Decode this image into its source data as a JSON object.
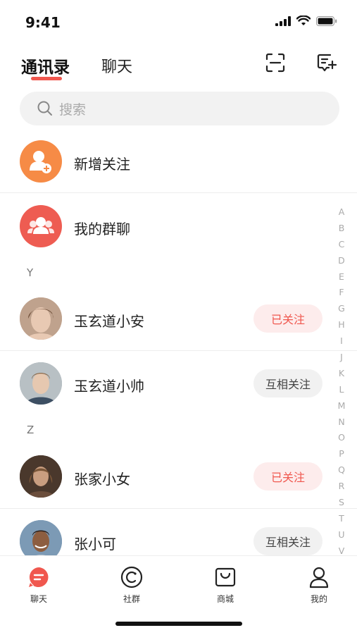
{
  "status_bar": {
    "time": "9:41"
  },
  "header": {
    "tabs": [
      {
        "label": "通讯录",
        "active": true
      },
      {
        "label": "聊天",
        "active": false
      }
    ],
    "icons": [
      "scan-icon",
      "compose-message-icon"
    ]
  },
  "search": {
    "placeholder": "搜索"
  },
  "shortcuts": [
    {
      "label": "新增关注",
      "icon": "add-user-icon",
      "color": "#f68b46"
    },
    {
      "label": "我的群聊",
      "icon": "group-icon",
      "color": "#ee5c52"
    }
  ],
  "sections": [
    {
      "letter": "Y",
      "contacts": [
        {
          "name": "玉玄道小安",
          "follow_label": "已关注",
          "follow_state": "followed"
        },
        {
          "name": "玉玄道小帅",
          "follow_label": "互相关注",
          "follow_state": "mutual"
        }
      ]
    },
    {
      "letter": "Z",
      "contacts": [
        {
          "name": "张家小女",
          "follow_label": "已关注",
          "follow_state": "followed"
        },
        {
          "name": "张小可",
          "follow_label": "互相关注",
          "follow_state": "mutual"
        }
      ]
    }
  ],
  "alphabet_index": [
    "A",
    "B",
    "C",
    "D",
    "E",
    "F",
    "G",
    "H",
    "I",
    "J",
    "K",
    "L",
    "M",
    "N",
    "O",
    "P",
    "Q",
    "R",
    "S",
    "T",
    "U",
    "V"
  ],
  "bottom_nav": [
    {
      "label": "聊天",
      "icon": "chat-icon",
      "active": true
    },
    {
      "label": "社群",
      "icon": "community-icon",
      "active": false
    },
    {
      "label": "商城",
      "icon": "shop-icon",
      "active": false
    },
    {
      "label": "我的",
      "icon": "profile-icon",
      "active": false
    }
  ],
  "colors": {
    "accent": "#f0574e",
    "orange": "#f68b46"
  }
}
